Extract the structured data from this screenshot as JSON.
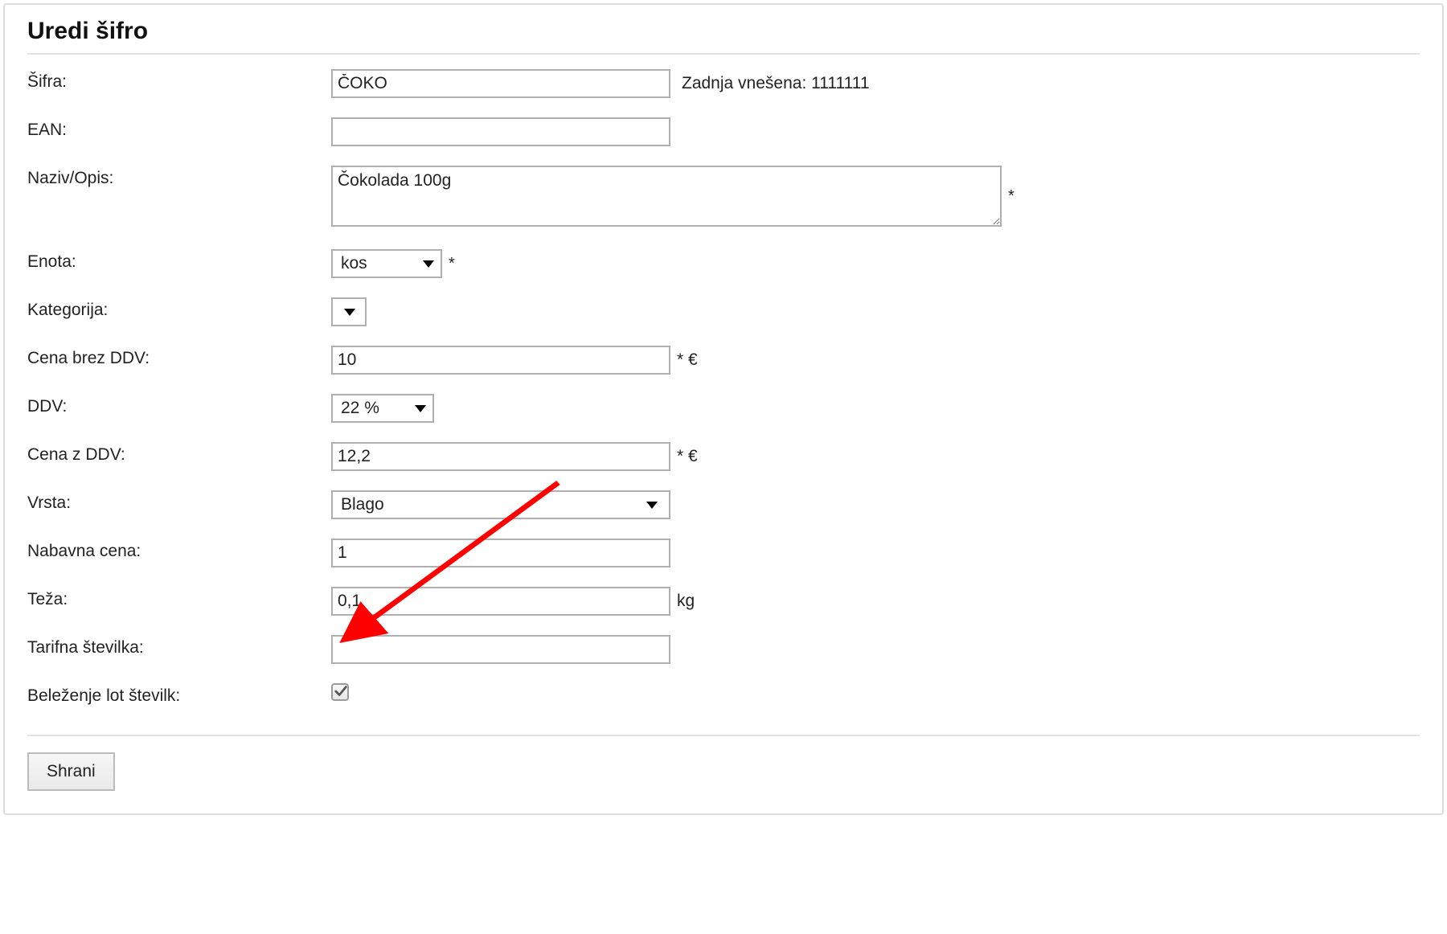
{
  "title": "Uredi šifro",
  "labels": {
    "sifra": "Šifra:",
    "ean": "EAN:",
    "naziv": "Naziv/Opis:",
    "enota": "Enota:",
    "kategorija": "Kategorija:",
    "cena_brez_ddv": "Cena brez DDV:",
    "ddv": "DDV:",
    "cena_z_ddv": "Cena z DDV:",
    "vrsta": "Vrsta:",
    "nabavna_cena": "Nabavna cena:",
    "teza": "Teža:",
    "tarifna": "Tarifna številka:",
    "belezenje_lot": "Beleženje lot številk:"
  },
  "values": {
    "sifra": "ČOKO",
    "ean": "",
    "naziv": "Čokolada 100g",
    "enota": "kos",
    "kategorija": "",
    "cena_brez_ddv": "10",
    "ddv": "22 %",
    "cena_z_ddv": "12,2",
    "vrsta": "Blago",
    "nabavna_cena": "1",
    "teza": "0,1",
    "tarifna": "",
    "belezenje_lot_checked": true
  },
  "suffixes": {
    "eur": "€",
    "kg": "kg",
    "star": "*",
    "star_eur": "* €"
  },
  "info": {
    "zadnja_vnesena_label": "Zadnja vnešena: ",
    "zadnja_vnesena_value": "1111111"
  },
  "buttons": {
    "shrani": "Shrani"
  }
}
